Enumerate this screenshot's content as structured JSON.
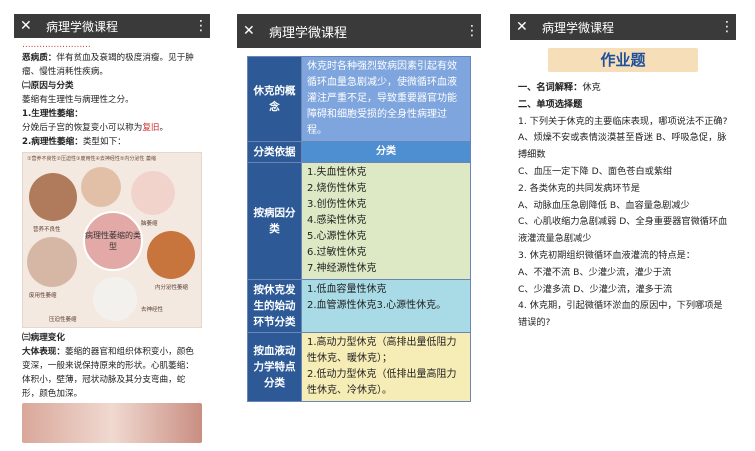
{
  "screen1": {
    "title": "病理学微课程",
    "top_partial": "……………………",
    "p1a": "恶病质：",
    "p1b": "伴有贫血及衰竭的极度消瘦。见于肿瘤、慢性消耗性疾病。",
    "p2": "㈡原因与分类",
    "p3": "萎缩有生理性与病理性之分。",
    "p4": "1.生理性萎缩：",
    "p5a": "分娩后子宫的恢复变小可以称为",
    "p5b": "复旧",
    "p5c": "。",
    "p6a": "2.病理性萎缩：",
    "p6b": "类型如下：",
    "illus": {
      "header": "①营养不良性②压迫性③废用性④去神经性⑤内分泌性 萎缩",
      "center": "病理性萎缩的类型",
      "labels": [
        "营养不良性",
        "脑萎缩",
        "废用性萎缩",
        "内分泌性萎缩",
        "压迫性萎缩",
        "去神经性"
      ]
    },
    "p7": "㈢病理变化",
    "p8a": "大体表现：",
    "p8b": "萎缩的器官和组织体积变小，颜色变深，一般来说保持原来的形状。心肌萎缩：体积小，壁薄，冠状动脉及其分支弯曲，蛇形，颜色加深。"
  },
  "screen2": {
    "title": "病理学微课程",
    "rows": [
      {
        "label": "休克的概念",
        "value": "休克时各种强烈致病因素引起有效循环血量急剧减少，使微循环血液灌注严重不足，导致重要器官功能障碍和细胞受损的全身性病理过程。"
      },
      {
        "label": "分类依据",
        "value": "分类"
      },
      {
        "label": "按病因分类",
        "items": [
          "1.失血性休克",
          "2.烧伤性休克",
          "3.创伤性休克",
          "4.感染性休克",
          "5.心源性休克",
          "6.过敏性休克",
          "7.神经源性休克"
        ]
      },
      {
        "label": "按休克发生的始动环节分类",
        "value": "1.低血容量性休克\n2.血管源性休克3.心源性休克。"
      },
      {
        "label": "按血液动力学特点分类",
        "value": "1.高动力型休克（高排出量低阻力性休克、暖休克）；\n2.低动力型休克（低排出量高阻力性休克、冷休克）。"
      }
    ]
  },
  "screen3": {
    "title": "病理学微课程",
    "heading": "作业题",
    "s1": "一、名词解释：",
    "s1v": "休克",
    "s2": "二、单项选择题",
    "q1": "1.  下列关于休克的主要临床表现，哪项说法不正确?",
    "q1a": "A、烦燥不安或表情淡漠甚至昏迷        B、呼吸急促，脉搏细数",
    "q1c": "C、血压一定下降                 D、面色苍白或紫绀",
    "q2": "2.  各类休克的共同发病环节是",
    "q2a": "A、动脉血压急剧降低            B、血容量急剧减少",
    "q2c": "C、心肌收缩力急剧减弱          D、全身重要器官微循环血液灌流量急剧减少",
    "q3": "3.  休克初期组织微循环血液灌流的特点是：",
    "q3a": "A、不灌不流         B、少灌少流，灌少于流",
    "q3c": "C、少灌多流         D、少灌少流，灌多于流",
    "q4": "4.  休克期，引起微循环淤血的原因中，下列哪项是错误的?"
  }
}
